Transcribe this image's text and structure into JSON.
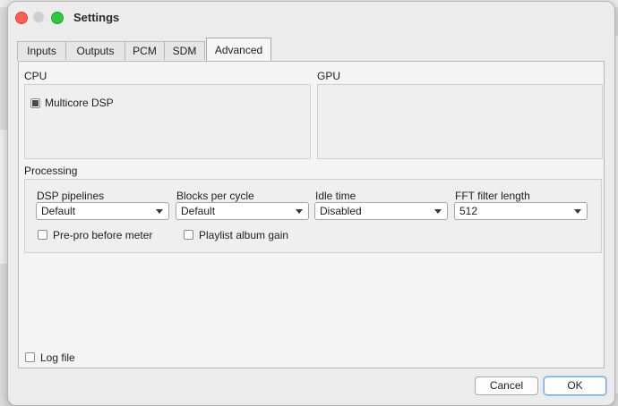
{
  "window": {
    "title": "Settings"
  },
  "tabs": [
    {
      "label": "Inputs"
    },
    {
      "label": "Outputs"
    },
    {
      "label": "PCM"
    },
    {
      "label": "SDM"
    },
    {
      "label": "Advanced",
      "active": true
    }
  ],
  "cpu": {
    "label": "CPU",
    "multicore": {
      "label": "Multicore DSP",
      "checked": true
    }
  },
  "gpu": {
    "label": "GPU"
  },
  "processing": {
    "label": "Processing",
    "dsp_pipelines": {
      "label": "DSP pipelines",
      "value": "Default"
    },
    "blocks_per_cycle": {
      "label": "Blocks per cycle",
      "value": "Default"
    },
    "idle_time": {
      "label": "Idle time",
      "value": "Disabled"
    },
    "fft_filter_length": {
      "label": "FFT filter length",
      "value": "512"
    },
    "prepro": {
      "label": "Pre-pro before meter",
      "checked": false
    },
    "playlist_gain": {
      "label": "Playlist album gain",
      "checked": false
    }
  },
  "log_file": {
    "label": "Log file",
    "checked": false
  },
  "buttons": {
    "cancel": "Cancel",
    "ok": "OK"
  }
}
